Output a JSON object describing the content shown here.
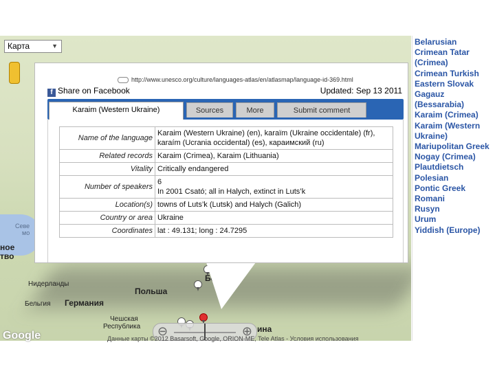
{
  "map": {
    "type_selector": "Карта",
    "labels": {
      "north_sea_1": "Севе",
      "north_sea_2": "мо",
      "left_1": "ное",
      "left_2": "тво",
      "netherlands": "Нидерланды",
      "belgium": "Бельгия",
      "germany": "Германия",
      "czech_1": "Чешская",
      "czech_2": "Республика",
      "poland": "Польша",
      "belarus": "Белар",
      "ukraine": "ина"
    },
    "logo": "Google",
    "copyright": "Данные карты ©2012 Basarsoft, Google, ORION-ME, Tele Atlas - Условия использования"
  },
  "info": {
    "url": "http://www.unesco.org/culture/languages-atlas/en/atlasmap/language-id-369.html",
    "share": "Share on Facebook",
    "updated": "Updated: Sep 13 2011",
    "tabs": [
      "Karaim (Western Ukraine)",
      "Sources",
      "More",
      "Submit comment"
    ],
    "rows": [
      {
        "k": "Name of the language",
        "v": "Karaim (Western Ukraine) (en), karaïm (Ukraine occidentale) (fr), karaím (Ucrania occidental) (es), караимский (ru)"
      },
      {
        "k": "Related records",
        "v": "Karaim (Crimea), Karaim (Lithuania)"
      },
      {
        "k": "Vitality",
        "v": "Critically endangered"
      },
      {
        "k": "Number of speakers",
        "v": "6\nIn 2001 Csató; all in Halych, extinct in Luts’k"
      },
      {
        "k": "Location(s)",
        "v": "towns of Luts’k (Lutsk) and Halych (Galich)"
      },
      {
        "k": "Country or area",
        "v": "Ukraine"
      },
      {
        "k": "Coordinates",
        "v": "lat : 49.131; long : 24.7295"
      }
    ]
  },
  "languages": [
    "Belarusian",
    "Crimean Tatar (Crimea)",
    "Crimean Turkish",
    "Eastern Slovak",
    "Gagauz (Bessarabia)",
    "Karaim (Crimea)",
    "Karaim (Western Ukraine)",
    "Mariupolitan Greek",
    "Nogay (Crimea)",
    "Plautdietsch",
    "Polesian",
    "Pontic Greek",
    "Romani",
    "Rusyn",
    "Urum",
    "Yiddish (Europe)"
  ],
  "colors": {
    "tabbar": "#2a65b4",
    "link": "#2a55a5",
    "facebook": "#3b5998",
    "marker_selected": "#e03030"
  }
}
